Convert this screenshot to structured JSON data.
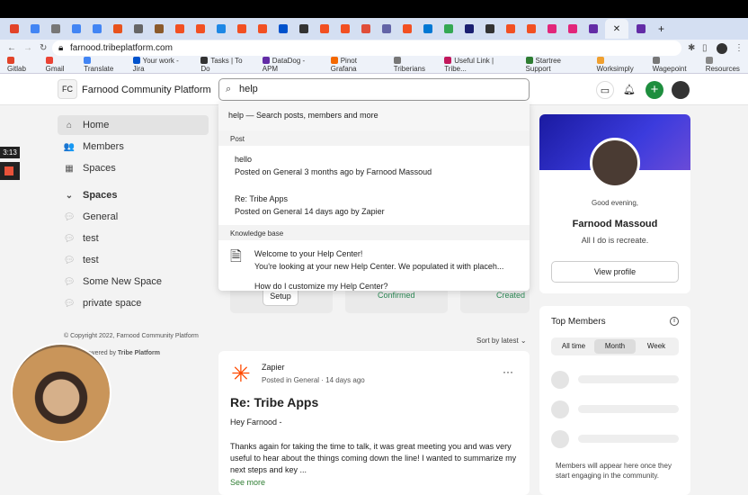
{
  "browser": {
    "url": "farnood.tribeplatform.com",
    "active_tab_close": "✕",
    "new_tab": "+",
    "tab_colors": [
      "#e24329",
      "#4285f4",
      "#777",
      "#4285f4",
      "#4285f4",
      "#e8531d",
      "#666",
      "#8b5a2b",
      "#f25022",
      "#f25022",
      "#1e88e5",
      "#f25022",
      "#f25022",
      "#0052cc",
      "#333",
      "#f25022",
      "#f25022",
      "#e04e39",
      "#6264a7",
      "#f25022",
      "#0078d4",
      "#34a853",
      "#1a1f71",
      "#333",
      "#f25022",
      "#f25022",
      "#e2267a",
      "#e2267a",
      "#632ca6",
      "#632ca6"
    ],
    "bookmarks": [
      {
        "label": "Gitlab",
        "color": "#e24329"
      },
      {
        "label": "Gmail",
        "color": "#ea4335"
      },
      {
        "label": "Translate",
        "color": "#4285f4"
      },
      {
        "label": "Your work - Jira",
        "color": "#0052cc"
      },
      {
        "label": "Tasks | To Do",
        "color": "#333"
      },
      {
        "label": "DataDog - APM",
        "color": "#632ca6"
      },
      {
        "label": "Pinot Grafana",
        "color": "#f46800"
      },
      {
        "label": "Triberians",
        "color": "#777"
      },
      {
        "label": "Useful Link | Tribe...",
        "color": "#c2185b"
      },
      {
        "label": "Startree Support",
        "color": "#2e7d32"
      },
      {
        "label": "Worksimply",
        "color": "#f0a030"
      },
      {
        "label": "Wagepoint",
        "color": "#777"
      },
      {
        "label": "Resources",
        "color": "#888"
      }
    ]
  },
  "overlay": {
    "timer": "3:13"
  },
  "header": {
    "logo": "FC",
    "brand": "Farnood Community Platform",
    "search_value": "help"
  },
  "sidebar": {
    "items": [
      {
        "label": "Home",
        "icon": "⌂"
      },
      {
        "label": "Members",
        "icon": "👥"
      },
      {
        "label": "Spaces",
        "icon": "▦"
      }
    ],
    "spaces_heading": "Spaces",
    "spaces": [
      "General",
      "test",
      "test",
      "Some New Space",
      "private space"
    ],
    "copyright": "© Copyright 2022, Farnood Community Platform",
    "powered_prefix": "Powered by",
    "powered_brand": "Tribe Platform"
  },
  "search_dropdown": {
    "query_line": "help — Search posts, members and more",
    "post_heading": "Post",
    "posts": [
      {
        "title": "hello",
        "meta": "Posted on General 3 months ago by Farnood Massoud"
      },
      {
        "title": "Re: Tribe Apps",
        "meta": "Posted on General 14 days ago by Zapier"
      }
    ],
    "kb_heading": "Knowledge base",
    "kb": [
      {
        "title": "Welcome to your Help Center!",
        "desc": "You're looking at your new Help Center. We populated it with placeh..."
      },
      {
        "title": "How do I customize my Help Center?"
      }
    ]
  },
  "feed": {
    "setup": "Setup",
    "confirmed": "Confirmed",
    "created": "Created",
    "sort": "Sort by latest",
    "post": {
      "author": "Zapier",
      "meta": "Posted in General · 14 days ago",
      "title": "Re: Tribe Apps",
      "greeting": "Hey Farnood -",
      "body": "Thanks again for taking the time to talk, it was great meeting you and was very useful to hear about the things coming down the line! I wanted to summarize my next steps and key ...",
      "see_more": "See more"
    }
  },
  "profile": {
    "greeting": "Good evening,",
    "name": "Farnood Massoud",
    "bio": "All I do is recreate.",
    "button": "View profile"
  },
  "top_members": {
    "title": "Top Members",
    "tabs": [
      "All time",
      "Month",
      "Week"
    ],
    "active_tab": 1,
    "empty": "Members will appear here once they start engaging in the community."
  }
}
